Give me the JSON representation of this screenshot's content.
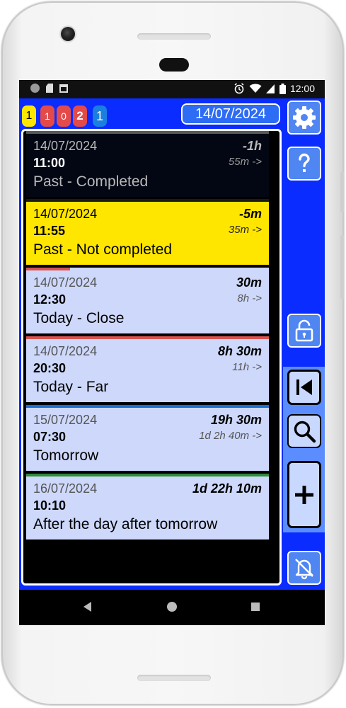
{
  "status_bar": {
    "time": "12:00"
  },
  "badges": [
    "1",
    "1",
    "0",
    "2",
    "1"
  ],
  "header": {
    "date": "14/07/2024"
  },
  "events": [
    {
      "date": "14/07/2024",
      "time": "11:00",
      "title": "Past - Completed",
      "delta": "-1h",
      "until": "55m ->",
      "bg": "#030714",
      "date_color": "#b8b8b8",
      "time_color": "#ffffff",
      "title_color": "#b8b8b8",
      "delta_color": "#b8b8b8",
      "bar_color": "#5a5a5a",
      "bar_fill": 1.0
    },
    {
      "date": "14/07/2024",
      "time": "11:55",
      "title": "Past - Not completed",
      "delta": "-5m",
      "until": "35m ->",
      "bg": "#ffe600",
      "date_color": "#000000",
      "time_color": "#000000",
      "title_color": "#000000",
      "delta_color": "#000000",
      "bar_color": "#1a1a1a",
      "bar_fill": 1.0
    },
    {
      "date": "14/07/2024",
      "time": "12:30",
      "title": "Today - Close",
      "delta": "30m",
      "until": "8h ->",
      "bg": "#cdd8fb",
      "date_color": "#555555",
      "time_color": "#000000",
      "title_color": "#000000",
      "delta_color": "#000000",
      "bar_color": "#d9534f",
      "bar_fill": 0.18
    },
    {
      "date": "14/07/2024",
      "time": "20:30",
      "title": "Today - Far",
      "delta": "8h 30m",
      "until": "11h ->",
      "bg": "#cdd8fb",
      "date_color": "#555555",
      "time_color": "#000000",
      "title_color": "#000000",
      "delta_color": "#000000",
      "bar_color": "#d9534f",
      "bar_fill": 1.0
    },
    {
      "date": "15/07/2024",
      "time": "07:30",
      "title": "Tomorrow",
      "delta": "19h 30m",
      "until": "1d 2h 40m ->",
      "bg": "#cdd8fb",
      "date_color": "#555555",
      "time_color": "#000000",
      "title_color": "#000000",
      "delta_color": "#000000",
      "bar_color": "#1b6fd0",
      "bar_fill": 1.0
    },
    {
      "date": "16/07/2024",
      "time": "10:10",
      "title": "After the day after tomorrow",
      "delta": "1d 22h 10m",
      "until": "",
      "bg": "#cdd8fb",
      "date_color": "#555555",
      "time_color": "#000000",
      "title_color": "#000000",
      "delta_color": "#000000",
      "bar_color": "#2e8b3a",
      "bar_fill": 1.0
    }
  ],
  "icons": {
    "settings": "gear-icon",
    "help": "question-icon",
    "lock": "unlock-icon",
    "first": "skip-first-icon",
    "search": "search-icon",
    "add": "plus-icon",
    "notifications": "bell-off-icon"
  },
  "colors": {
    "screen_bg": "#0a2cff",
    "side_button": "#4f86f2",
    "nav_panel": "#5c8dff"
  }
}
